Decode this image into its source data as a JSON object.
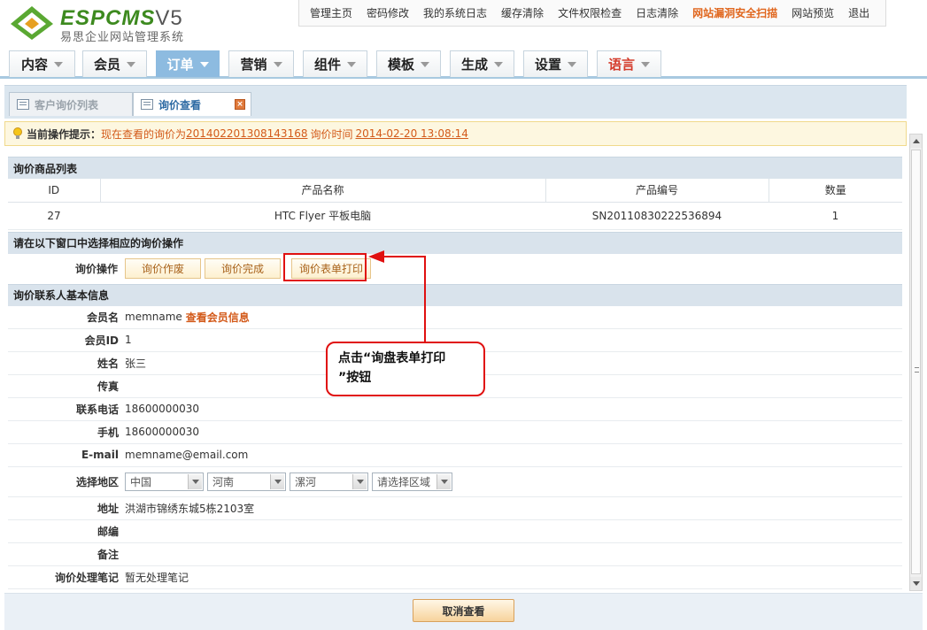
{
  "brand": {
    "logo": "ESPCMS",
    "version": "V5",
    "subtitle": "易思企业网站管理系统",
    "accent": "#e0661d"
  },
  "top_menu": [
    "管理主页",
    "密码修改",
    "我的系统日志",
    "缓存清除",
    "文件权限检查",
    "日志清除",
    "网站漏洞安全扫描",
    "网站预览",
    "退出"
  ],
  "top_menu_highlight": "网站漏洞安全扫描",
  "nav": [
    "内容",
    "会员",
    "订单",
    "营销",
    "组件",
    "模板",
    "生成",
    "设置",
    "语言"
  ],
  "nav_active": "订单",
  "subtabs": {
    "list": "客户询价列表",
    "view": "询价查看"
  },
  "tip": {
    "label": "当前操作提示：",
    "text1": "现在查看的询价为",
    "id_link": "201402201308143168",
    "text2": "询价时间",
    "time_link": "2014-02-20 13:08:14"
  },
  "product_section": {
    "title": "询价商品列表",
    "headers": [
      "ID",
      "产品名称",
      "产品编号",
      "数量"
    ],
    "row": [
      "27",
      "HTC Flyer 平板电脑",
      "SN20110830222536894",
      "1"
    ]
  },
  "op_section": {
    "title": "请在以下窗口中选择相应的询价操作",
    "label": "询价操作",
    "buttons": [
      "询价作废",
      "询价完成",
      "询价表单打印"
    ]
  },
  "contact_section": {
    "title": "询价联系人基本信息"
  },
  "contact": {
    "member_name_label": "会员名",
    "member_name": "memname",
    "member_link": "查看会员信息",
    "member_id_label": "会员ID",
    "member_id": "1",
    "name_label": "姓名",
    "name": "张三",
    "fax_label": "传真",
    "fax": "",
    "tel_label": "联系电话",
    "tel": "18600000030",
    "mobile_label": "手机",
    "mobile": "18600000030",
    "email_label": "E-mail",
    "email": "memname@email.com",
    "region_label": "选择地区",
    "regions": [
      "中国",
      "河南",
      "漯河",
      "请选择区域"
    ],
    "address_label": "地址",
    "address": "洪湖市锦绣东城5栋2103室",
    "zip_label": "邮编",
    "zip": "",
    "remark_label": "备注",
    "remark": "",
    "note_label": "询价处理笔记",
    "note": "暂无处理笔记"
  },
  "cancel_button": "取消查看",
  "callout": {
    "line1": "点击“询盘表单打印",
    "line2": "”按钮"
  }
}
